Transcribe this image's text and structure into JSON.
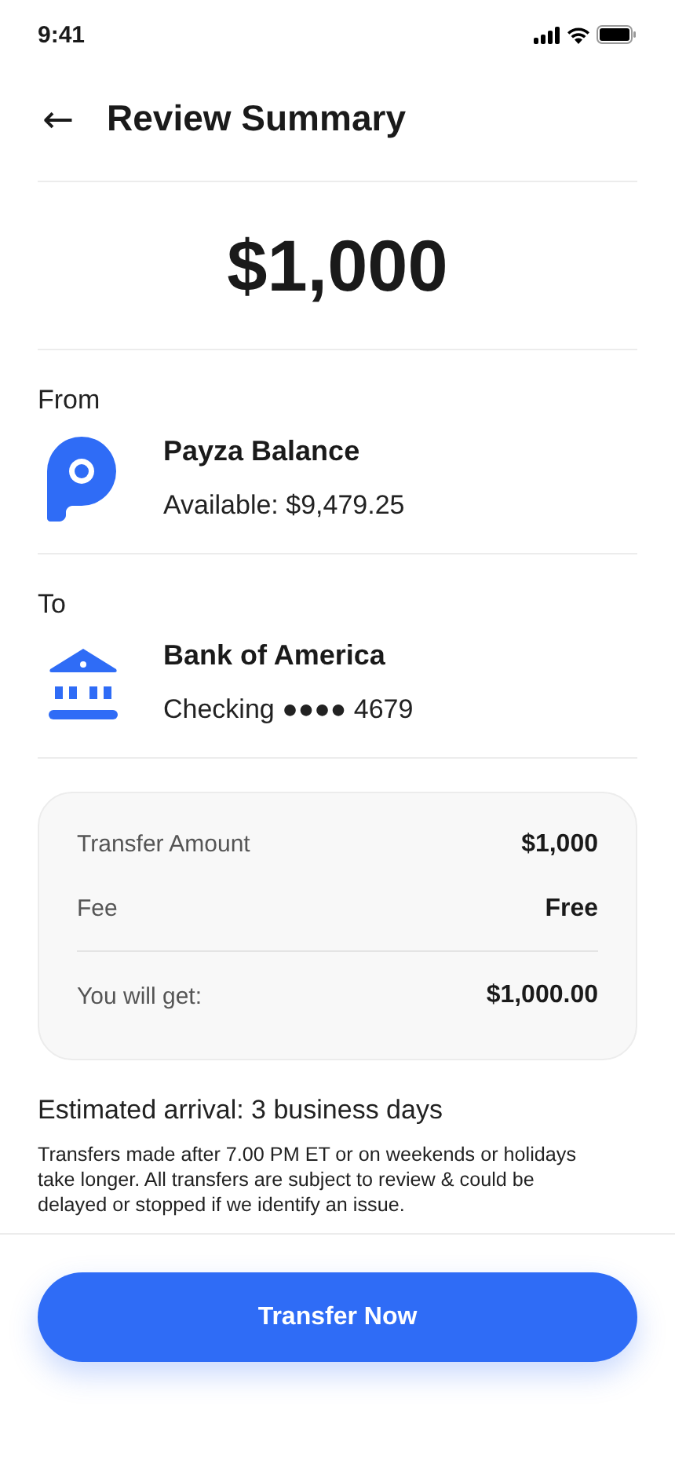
{
  "status_bar": {
    "time": "9:41"
  },
  "header": {
    "back": "←",
    "title": "Review Summary"
  },
  "amount": "$1,000",
  "parties": [
    {
      "label": "From",
      "kind": "wallet",
      "name": "Payza Balance",
      "detail": "Available: $9,479.25"
    },
    {
      "label": "To",
      "kind": "bank",
      "name": "Bank of America",
      "detail": "Checking ●●●● 4679"
    }
  ],
  "summary": [
    {
      "label": "Transfer Amount",
      "value": "$1,000"
    },
    {
      "label": "Fee",
      "value": "Free"
    },
    {
      "label": "You will get:",
      "value": "$1,000.00",
      "total": true
    }
  ],
  "arrival": "Estimated arrival: 3 business days",
  "note": "Transfers made after 7.00 PM ET or on weekends or holidays take longer. All transfers are subject to review & could be delayed or stopped if we identify an issue.",
  "button": "Transfer Now"
}
